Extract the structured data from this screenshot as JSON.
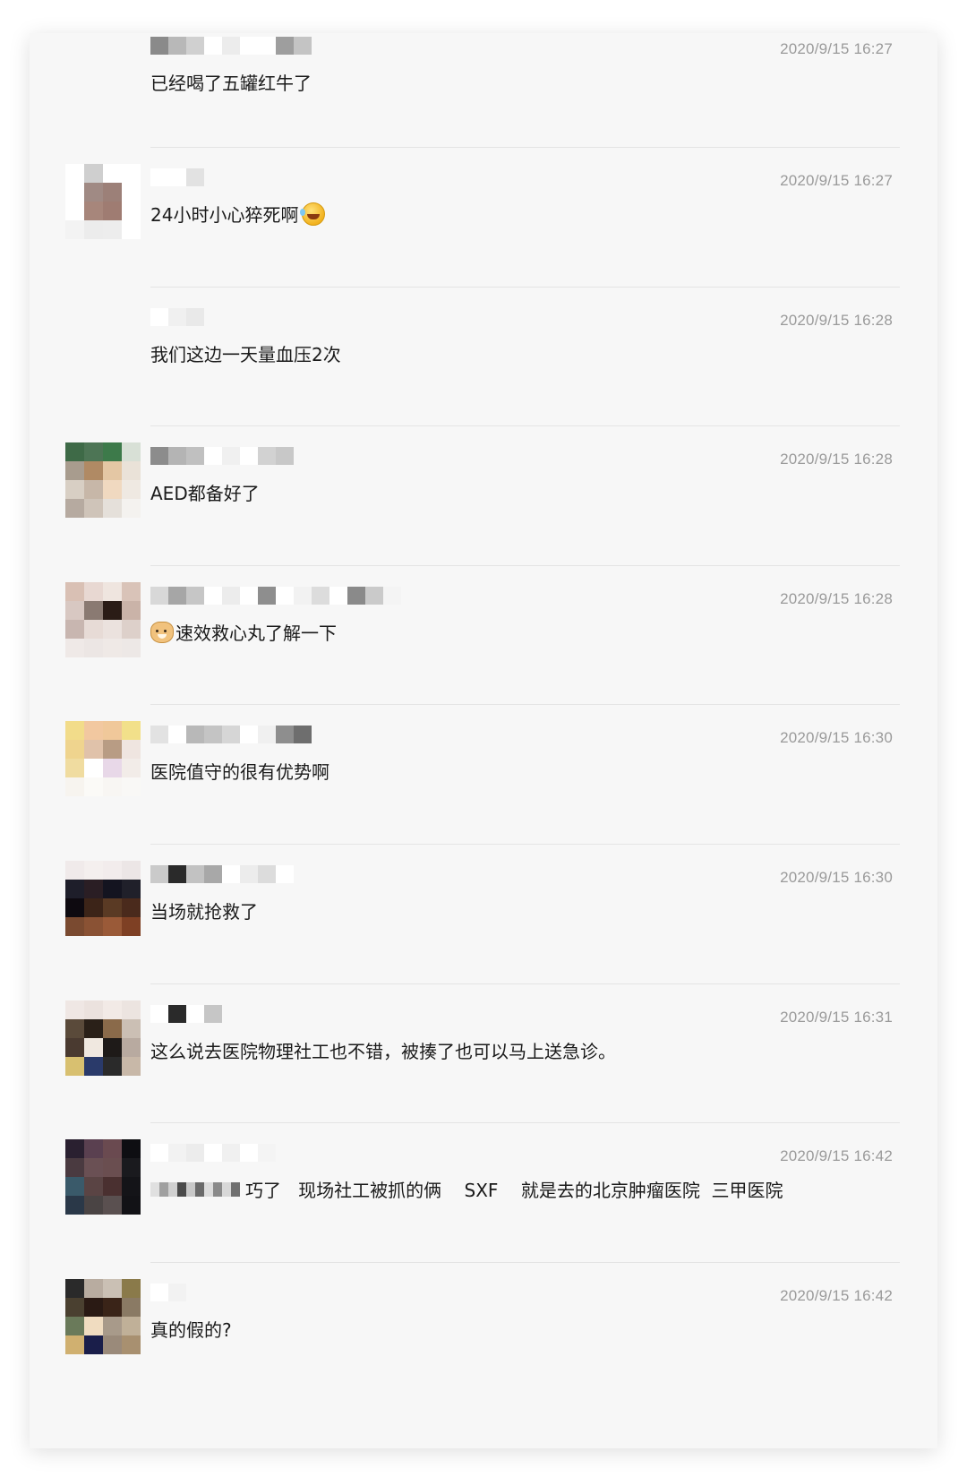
{
  "colors": {
    "panel_bg": "#f7f7f7",
    "divider": "#e4e4e4",
    "timestamp": "#9a9a9a",
    "message_text": "#1a1a1a"
  },
  "messages": [
    {
      "time": "2020/9/15 16:27",
      "text": "已经喝了五罐红牛了",
      "avatar": null,
      "name_blocks": [
        "#8a8a8a",
        "#b8b8b8",
        "#d0d0d0",
        "#ffffff",
        "#ececec",
        "#ffffff",
        "#ffffff",
        "#9e9e9e",
        "#c4c4c4"
      ]
    },
    {
      "time": "2020/9/15 16:27",
      "text": "24小时小心猝死啊",
      "emoji_after": "laugh-cry-emoji",
      "avatar": [
        "#ffffff",
        "#cfcfcf",
        "#ffffff",
        "#ffffff",
        "#ffffff",
        "#a08a84",
        "#9c8078",
        "#ffffff",
        "#ffffff",
        "#a7867b",
        "#9f7c72",
        "#ffffff",
        "#f3f3f3",
        "#ececec",
        "#ededed",
        "#ffffff"
      ],
      "name_blocks": [
        "#ffffff",
        "#ffffff",
        "#e2e2e2"
      ]
    },
    {
      "time": "2020/9/15 16:28",
      "text": "我们这边一天量血压2次",
      "avatar": null,
      "name_blocks": [
        "#ffffff",
        "#f0f0f0",
        "#e9e9e9"
      ]
    },
    {
      "time": "2020/9/15 16:28",
      "text": "AED都备好了",
      "avatar": [
        "#3e6a47",
        "#4d7555",
        "#3d7a4a",
        "#d8e0d6",
        "#a89c8e",
        "#b08a64",
        "#e4c7a4",
        "#eae2d8",
        "#d8cfc4",
        "#c7b7a8",
        "#f0d9c0",
        "#efe9e2",
        "#b6aaa0",
        "#cfc4b9",
        "#e5e0da",
        "#f4f2ef"
      ],
      "name_blocks": [
        "#8c8c8c",
        "#b4b4b4",
        "#c0c0c0",
        "#ffffff",
        "#f0f0f0",
        "#ffffff",
        "#d2d2d2",
        "#c8c8c8"
      ]
    },
    {
      "time": "2020/9/15 16:28",
      "text": "速效救心丸了解一下",
      "emoji_before": "doge-emoji",
      "avatar": [
        "#d9c0b4",
        "#e8d8d2",
        "#efe5df",
        "#d9c3b8",
        "#d8c8c2",
        "#8a7a72",
        "#2a1c16",
        "#cab3a8",
        "#c8b6b0",
        "#e7dbd6",
        "#ebe2de",
        "#ddd0ca",
        "#efe9e7",
        "#ece6e4",
        "#efe9e6",
        "#ede8e6"
      ],
      "name_blocks": [
        "#d8d8d8",
        "#a6a6a6",
        "#c6c6c6",
        "#ffffff",
        "#ececec",
        "#ffffff",
        "#8e8e8e",
        "#ffffff",
        "#f2f2f2",
        "#dcdcdc",
        "#ffffff",
        "#8a8a8a",
        "#cacaca",
        "#f4f4f4"
      ]
    },
    {
      "time": "2020/9/15 16:30",
      "text": "医院值守的很有优势啊",
      "avatar": [
        "#f2dc8a",
        "#f2c8a0",
        "#f0c89a",
        "#f2e08a",
        "#efd48e",
        "#e0c2aa",
        "#b89c84",
        "#efe5e0",
        "#f0dca0",
        "#ffffff",
        "#e8d8e8",
        "#f2ece8",
        "#f7f4ef",
        "#fbfaf7",
        "#f8f6f3",
        "#f9f8f6"
      ],
      "name_blocks": [
        "#e2e2e2",
        "#ffffff",
        "#b8b8b8",
        "#c4c4c4",
        "#d6d6d6",
        "#ffffff",
        "#f0f0f0",
        "#8e8e8e",
        "#6e6e6e"
      ]
    },
    {
      "time": "2020/9/15 16:30",
      "text": "当场就抢救了",
      "avatar": [
        "#f0eaea",
        "#f4efee",
        "#f2ecec",
        "#ece6e6",
        "#1e1e2a",
        "#2a1e24",
        "#141420",
        "#20202a",
        "#0e0a10",
        "#3c2418",
        "#5a3a24",
        "#4a2a1c",
        "#7a4a30",
        "#8a5234",
        "#9a5a38",
        "#7e4024"
      ],
      "name_blocks": [
        "#cacaca",
        "#2a2a2a",
        "#c2c2c2",
        "#a8a8a8",
        "#ffffff",
        "#ececec",
        "#dcdcdc",
        "#ffffff"
      ]
    },
    {
      "time": "2020/9/15 16:31",
      "text": "这么说去医院物理社工也不错，被揍了也可以马上送急诊。",
      "avatar": [
        "#efe7e4",
        "#ebe2de",
        "#f2eae6",
        "#ece4e0",
        "#5a4a3a",
        "#2a2018",
        "#8a6a4a",
        "#cbbfb4",
        "#4a3a30",
        "#f0e8e0",
        "#1e1a18",
        "#b8aaa0",
        "#d8c070",
        "#2a3a6a",
        "#2a2a2a",
        "#c8b8a8"
      ],
      "name_blocks": [
        "#ffffff",
        "#2a2a2a",
        "#ffffff",
        "#c6c6c6"
      ]
    },
    {
      "time": "2020/9/15 16:42",
      "text_prefix_blurred": true,
      "text": "巧了   现场社工被抓的俩    SXF    就是去的北京肿瘤医院  三甲医院",
      "avatar": [
        "#2a2030",
        "#5a4050",
        "#6a4a50",
        "#0e0e12",
        "#4a3a40",
        "#6a5054",
        "#6a4e50",
        "#1a1a1e",
        "#3a5a6a",
        "#5a4444",
        "#4a3030",
        "#141418",
        "#2a3848",
        "#4a4444",
        "#5a5050",
        "#121216"
      ],
      "name_blocks": [
        "#ffffff",
        "#f2f2f2",
        "#ececec",
        "#ffffff",
        "#f0f0f0",
        "#ffffff",
        "#f4f4f4"
      ]
    },
    {
      "time": "2020/9/15 16:42",
      "text": "真的假的?",
      "avatar": [
        "#2a2a2a",
        "#b8aca0",
        "#cac0b4",
        "#8a7a4a",
        "#4a4030",
        "#2a1a14",
        "#3a2418",
        "#8a7a64",
        "#6a7a5a",
        "#f0dcc0",
        "#a89a8a",
        "#c0b098",
        "#d0b070",
        "#1a1e4a",
        "#9a8a7a",
        "#a89070"
      ],
      "name_blocks": [
        "#ffffff",
        "#f2f2f2"
      ]
    }
  ]
}
